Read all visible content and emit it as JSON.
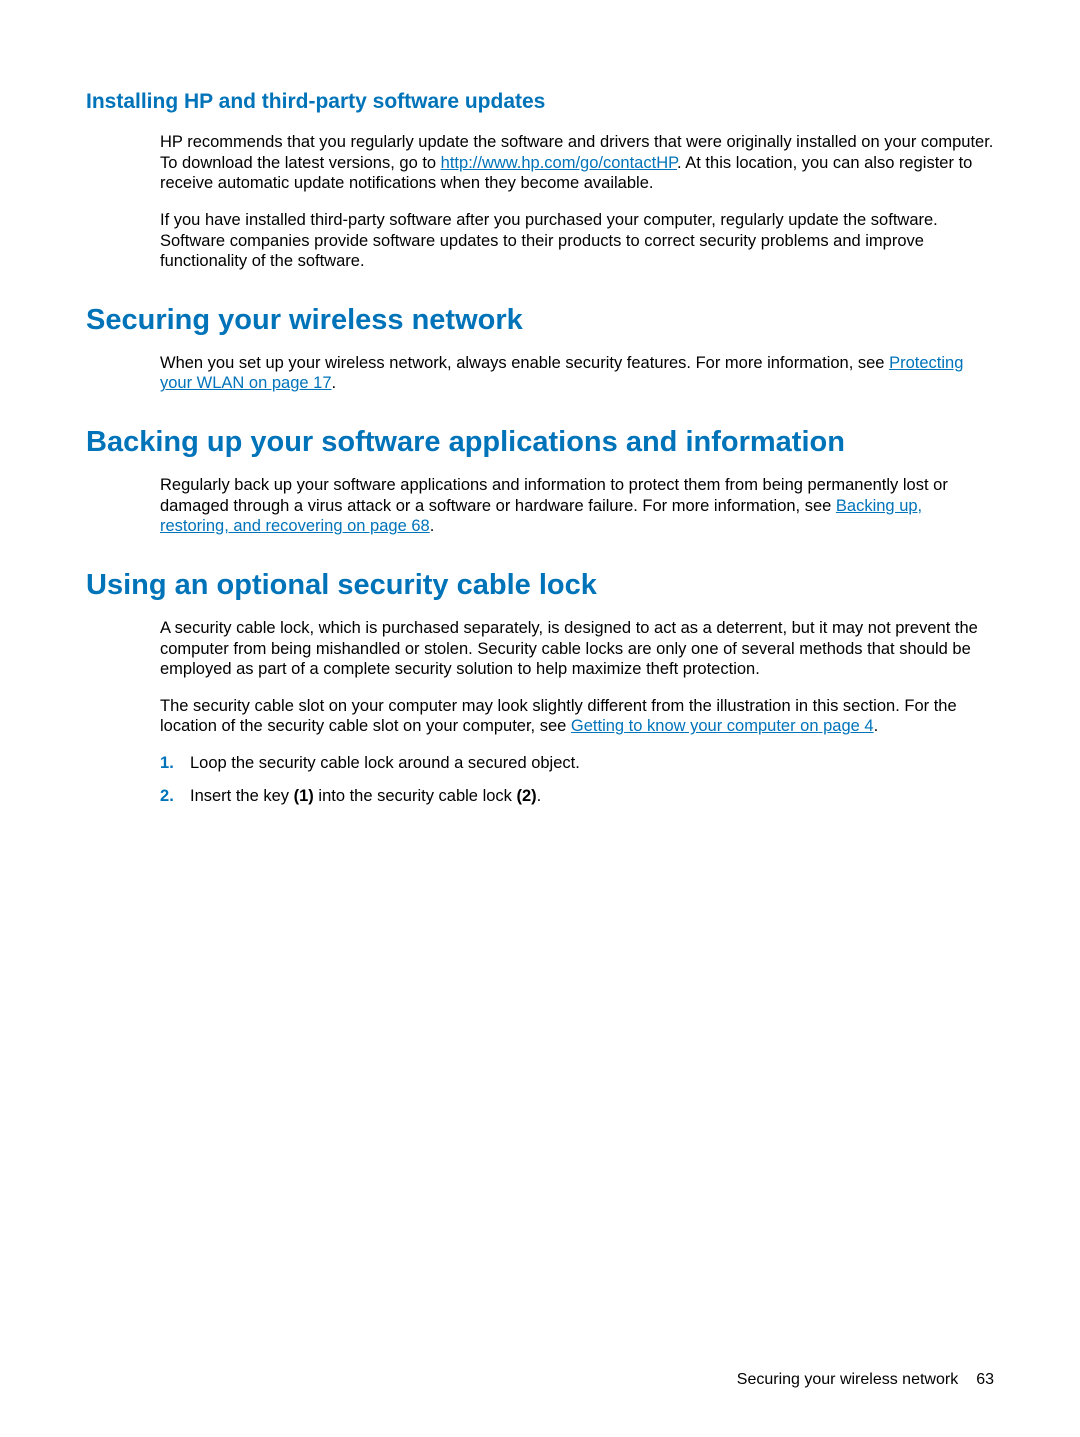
{
  "section1": {
    "title": "Installing HP and third-party software updates",
    "p1_a": "HP recommends that you regularly update the software and drivers that were originally installed on your computer. To download the latest versions, go to ",
    "p1_link": "http://www.hp.com/go/contactHP",
    "p1_b": ". At this location, you can also register to receive automatic update notifications when they become available.",
    "p2": "If you have installed third-party software after you purchased your computer, regularly update the software. Software companies provide software updates to their products to correct security problems and improve functionality of the software."
  },
  "section2": {
    "title": "Securing your wireless network",
    "p1_a": "When you set up your wireless network, always enable security features. For more information, see ",
    "p1_link": "Protecting your WLAN on page 17",
    "p1_b": "."
  },
  "section3": {
    "title": "Backing up your software applications and information",
    "p1_a": "Regularly back up your software applications and information to protect them from being permanently lost or damaged through a virus attack or a software or hardware failure. For more information, see ",
    "p1_link": "Backing up, restoring, and recovering on page 68",
    "p1_b": "."
  },
  "section4": {
    "title": "Using an optional security cable lock",
    "p1": "A security cable lock, which is purchased separately, is designed to act as a deterrent, but it may not prevent the computer from being mishandled or stolen. Security cable locks are only one of several methods that should be employed as part of a complete security solution to help maximize theft protection.",
    "p2_a": "The security cable slot on your computer may look slightly different from the illustration in this section. For the location of the security cable slot on your computer, see ",
    "p2_link": "Getting to know your computer on page 4",
    "p2_b": ".",
    "li1": "Loop the security cable lock around a secured object.",
    "li2_a": "Insert the key ",
    "li2_b": "(1)",
    "li2_c": " into the security cable lock ",
    "li2_d": "(2)",
    "li2_e": "."
  },
  "footer": {
    "text": "Securing your wireless network",
    "page": "63"
  }
}
